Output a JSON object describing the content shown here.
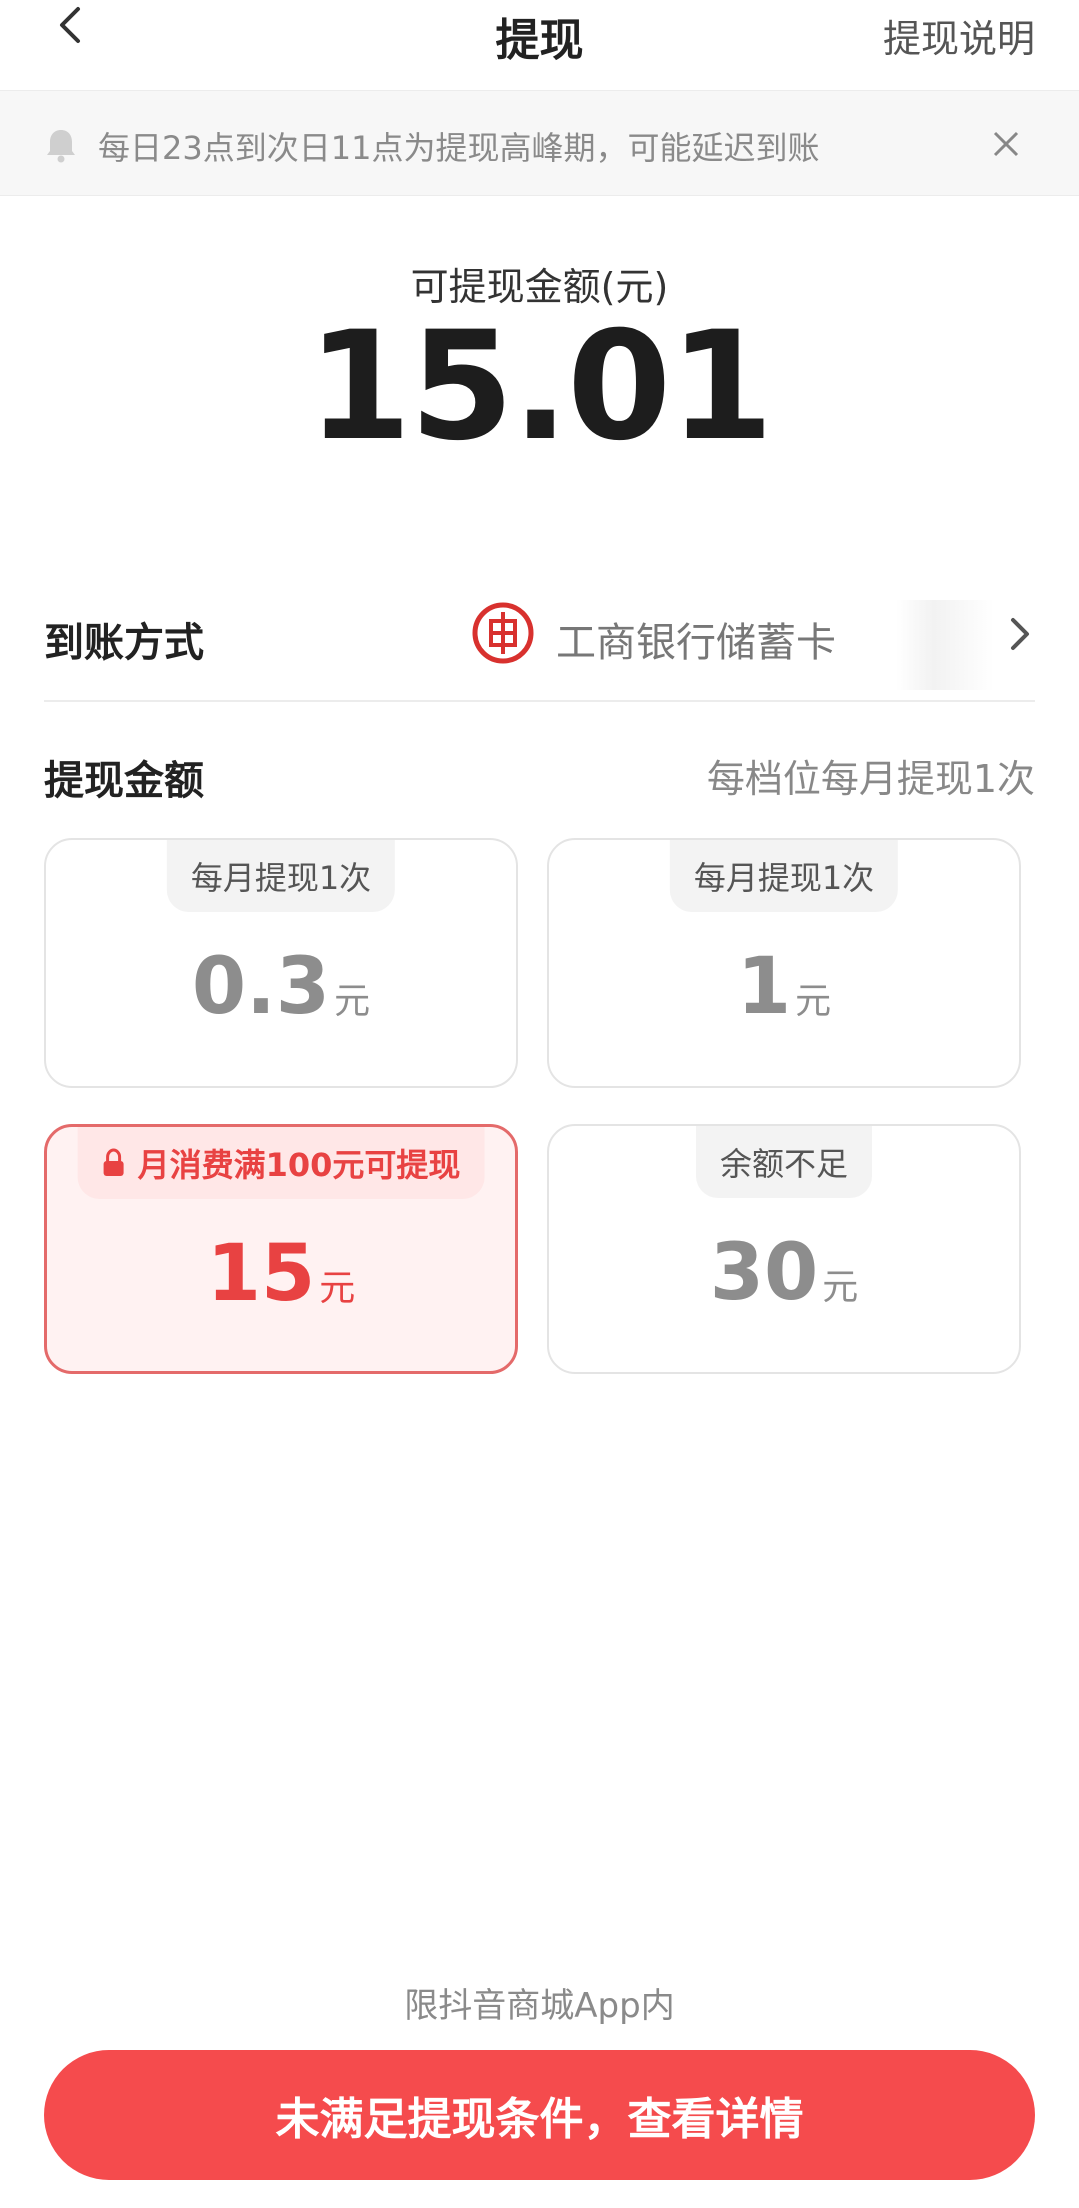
{
  "header": {
    "title": "提现",
    "help_link": "提现说明"
  },
  "notice": {
    "text": "每日23点到次日11点为提现高峰期，可能延迟到账"
  },
  "balance": {
    "label": "可提现金额(元)",
    "value": "15.01"
  },
  "method": {
    "label": "到账方式",
    "bank_name": "工商银行储蓄卡",
    "bank_icon": "icbc-logo-icon"
  },
  "amount": {
    "label": "提现金额",
    "hint": "每档位每月提现1次",
    "options": [
      {
        "badge": "每月提现1次",
        "value": "0.3",
        "unit": "元",
        "locked": false
      },
      {
        "badge": "每月提现1次",
        "value": "1",
        "unit": "元",
        "locked": false
      },
      {
        "badge": "月消费满100元可提现",
        "value": "15",
        "unit": "元",
        "locked": true
      },
      {
        "badge": "余额不足",
        "value": "30",
        "unit": "元",
        "locked": false
      }
    ]
  },
  "footer": {
    "note": "限抖音商城App内",
    "cta_label": "未满足提现条件，查看详情"
  },
  "colors": {
    "accent": "#f54b4d",
    "locked_text": "#e84242",
    "locked_bg": "#fff2f2"
  }
}
